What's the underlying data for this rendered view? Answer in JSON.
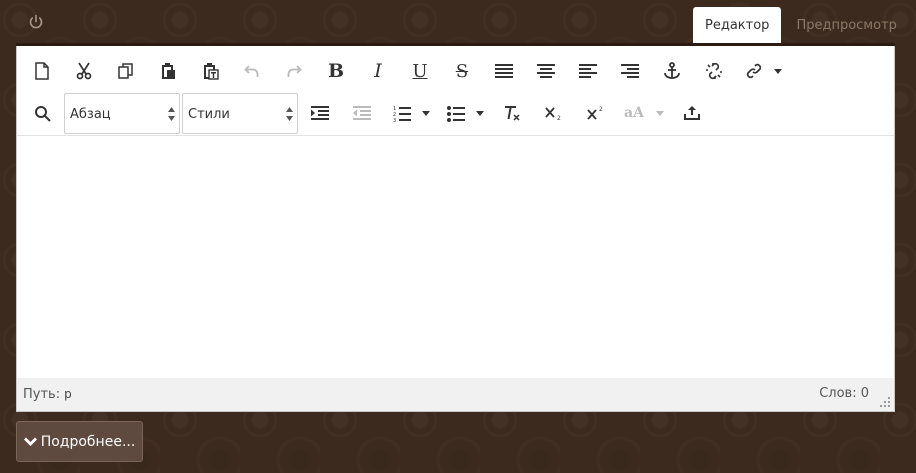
{
  "tabs": [
    {
      "label": "Редактор",
      "active": true
    },
    {
      "label": "Предпросмотр",
      "active": false
    }
  ],
  "toolbar": {
    "row1": [
      {
        "name": "new-document-icon"
      },
      {
        "name": "cut-icon"
      },
      {
        "name": "copy-icon"
      },
      {
        "name": "paste-icon"
      },
      {
        "name": "paste-text-icon"
      },
      {
        "name": "undo-icon",
        "disabled": true
      },
      {
        "name": "redo-icon",
        "disabled": true
      },
      {
        "name": "bold-icon",
        "glyph": "B"
      },
      {
        "name": "italic-icon",
        "glyph": "I"
      },
      {
        "name": "underline-icon",
        "glyph": "U"
      },
      {
        "name": "strikethrough-icon",
        "glyph": "S"
      },
      {
        "name": "align-justify-icon"
      },
      {
        "name": "align-center-icon"
      },
      {
        "name": "align-left-icon"
      },
      {
        "name": "align-right-icon"
      },
      {
        "name": "anchor-icon"
      },
      {
        "name": "unlink-icon"
      },
      {
        "name": "link-icon"
      }
    ],
    "format_select": "Абзац",
    "styles_select": "Стили",
    "font_size_glyph": "aA"
  },
  "status": {
    "path_label": "Путь:",
    "path_value": "p",
    "words": "Слов: 0"
  },
  "more_button": "Подробнее...",
  "colors": {
    "background": "#3d2a1e",
    "button": "#5e4a3e",
    "toolbar_icon": "#333333",
    "disabled_icon": "#bbbbbb"
  }
}
